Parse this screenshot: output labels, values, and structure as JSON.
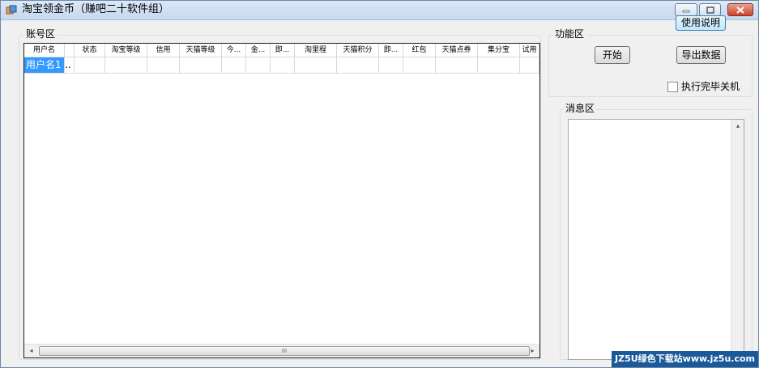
{
  "window": {
    "title": "淘宝领金币（赚吧二十软件组）",
    "controls": {
      "minimize_icon": "minimize-icon",
      "maximize_icon": "maximize-icon",
      "close_icon": "close-icon"
    }
  },
  "help_button": {
    "label": "使用说明"
  },
  "account_group": {
    "label": "账号区",
    "columns": [
      "用户名",
      "",
      "状态",
      "淘宝等级",
      "信用",
      "天猫等级",
      "今...",
      "金...",
      "即...",
      "淘里程",
      "天猫积分",
      "即...",
      "红包",
      "天猫点券",
      "集分宝",
      "试用"
    ],
    "rows": [
      {
        "cells": [
          "用户名1",
          "..",
          "",
          "",
          "",
          "",
          "",
          "",
          "",
          "",
          "",
          "",
          "",
          "",
          "",
          ""
        ]
      }
    ],
    "scrollbar": {
      "left_icon": "◂",
      "grip_icon": "III",
      "right_icon": "▸"
    }
  },
  "function_group": {
    "label": "功能区",
    "start_label": "开始",
    "export_label": "导出数据",
    "shutdown_label": "执行完毕关机",
    "shutdown_checked": false
  },
  "message_group": {
    "label": "消息区",
    "text": "",
    "scroll_up_icon": "▴"
  },
  "watermark": {
    "text": "JZ5U绿色下载站www.jz5u.com"
  },
  "colors": {
    "selection": "#3399ff",
    "window_bg": "#f0f0f0",
    "titlebar": "#c6d9f0"
  }
}
